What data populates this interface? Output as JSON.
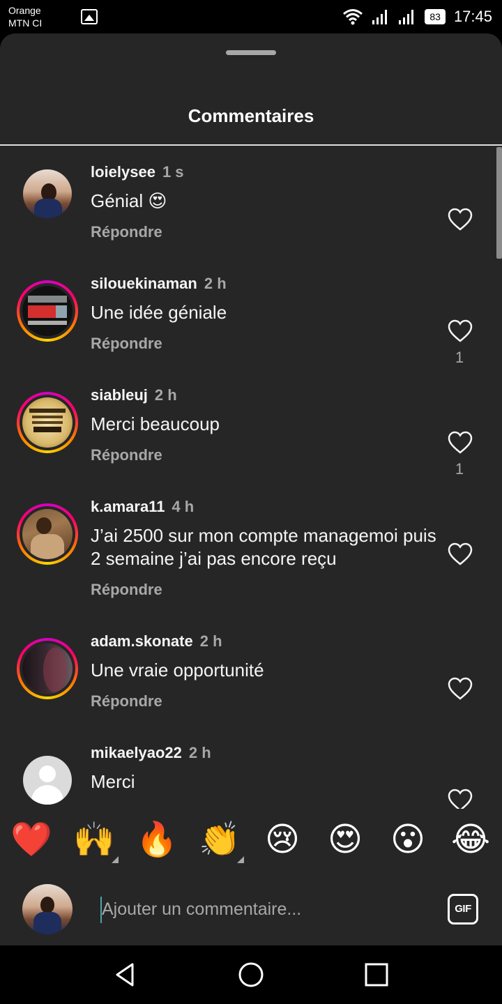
{
  "status_bar": {
    "carrier_line1": "Orange",
    "carrier_line2": "MTN CI",
    "battery": "83",
    "time": "17:45",
    "icons": [
      "image-icon",
      "wifi-icon",
      "signal-icon",
      "signal-icon",
      "battery-icon"
    ]
  },
  "sheet": {
    "title": "Commentaires"
  },
  "comments": [
    {
      "username": "loielysee",
      "time": "1 s",
      "text": "Génial 😍",
      "reply": "Répondre",
      "likes": "",
      "avatar": "avatar-photo"
    },
    {
      "username": "silouekinaman",
      "time": "2 h",
      "text": "Une idée géniale",
      "reply": "Répondre",
      "likes": "1",
      "avatar": "avatar-story"
    },
    {
      "username": "siableuj",
      "time": "2 h",
      "text": "Merci beaucoup",
      "reply": "Répondre",
      "likes": "1",
      "avatar": "avatar-story"
    },
    {
      "username": "k.amara11",
      "time": "4 h",
      "text": "J’ai 2500 sur mon compte managemoi puis 2 semaine j’ai pas encore reçu",
      "reply": "Répondre",
      "likes": "",
      "avatar": "avatar-story"
    },
    {
      "username": "adam.skonate",
      "time": "2 h",
      "text": "Une vraie opportunité",
      "reply": "Répondre",
      "likes": "",
      "avatar": "avatar-story"
    },
    {
      "username": "mikaelyao22",
      "time": "2 h",
      "text": "Merci",
      "reply": "",
      "likes": "",
      "avatar": "avatar-default"
    }
  ],
  "emoji_bar": [
    "❤️",
    "🙌",
    "🔥",
    "👏",
    "😢",
    "😍",
    "😮",
    "😂"
  ],
  "input": {
    "placeholder": "Ajouter un commentaire...",
    "gif_label": "GIF"
  },
  "nav_bar": [
    "back-icon",
    "home-icon",
    "recents-icon"
  ],
  "colors": {
    "sheet_bg": "#262626",
    "text_primary": "#f5f5f5",
    "text_secondary": "#a8a8a8",
    "status_bg": "#000000"
  }
}
